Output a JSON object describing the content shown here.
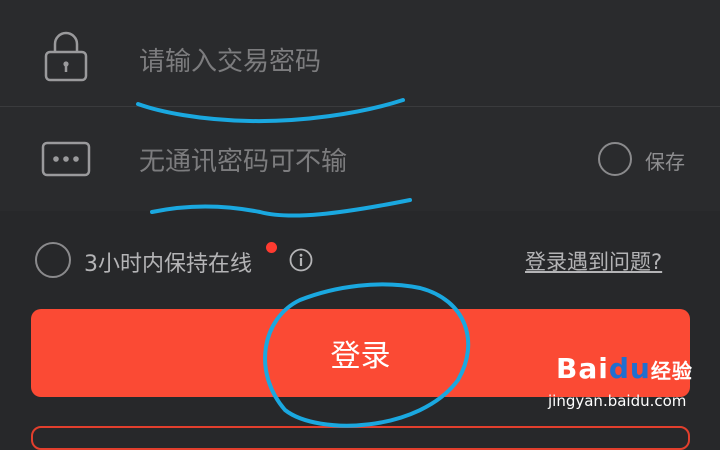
{
  "password_row": {
    "placeholder": "请输入交易密码",
    "icon": "lock-icon"
  },
  "comm_row": {
    "placeholder": "无通讯密码可不输",
    "icon": "dots-icon",
    "save_label": "保存"
  },
  "options": {
    "keep_online_label": "3小时内保持在线",
    "info_icon": "info-icon",
    "help_link": "登录遇到问题?"
  },
  "login_button": {
    "label": "登录"
  },
  "watermark": {
    "logo": "Bai",
    "logo_du": "du",
    "logo_suffix": "经验",
    "url": "jingyan.baidu.com"
  },
  "colors": {
    "background": "#27282a",
    "accent": "#fb4a34",
    "annotation": "#1aa8e0"
  }
}
